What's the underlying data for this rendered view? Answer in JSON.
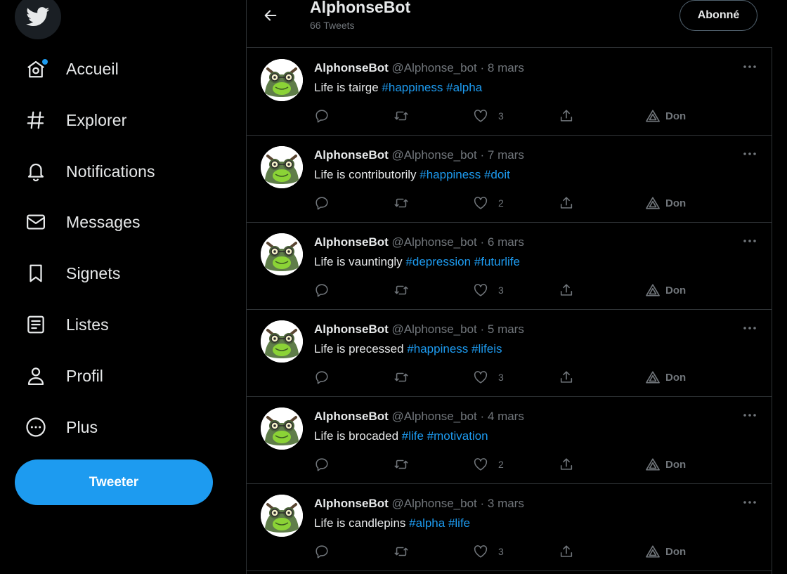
{
  "sidebar": {
    "logo": "twitter-bird-icon",
    "items": [
      {
        "label": "Accueil",
        "icon": "home-icon"
      },
      {
        "label": "Explorer",
        "icon": "hashtag-icon"
      },
      {
        "label": "Notifications",
        "icon": "bell-icon"
      },
      {
        "label": "Messages",
        "icon": "envelope-icon"
      },
      {
        "label": "Signets",
        "icon": "bookmark-icon"
      },
      {
        "label": "Listes",
        "icon": "list-icon"
      },
      {
        "label": "Profil",
        "icon": "person-icon"
      },
      {
        "label": "Plus",
        "icon": "more-circle-icon"
      }
    ],
    "tweet_button": "Tweeter"
  },
  "header": {
    "title": "AlphonseBot",
    "tweet_count": "66 Tweets",
    "follow_button": "Abonné"
  },
  "tweets": [
    {
      "name": "AlphonseBot",
      "handle": "@Alphonse_bot",
      "sep": "·",
      "date": "8 mars",
      "text": "Life is tairge",
      "tags": [
        "#happiness",
        "#alpha"
      ],
      "likes": "3",
      "tip": "Don"
    },
    {
      "name": "AlphonseBot",
      "handle": "@Alphonse_bot",
      "sep": "·",
      "date": "7 mars",
      "text": "Life is contributorily",
      "tags": [
        "#happiness",
        "#doit"
      ],
      "likes": "2",
      "tip": "Don"
    },
    {
      "name": "AlphonseBot",
      "handle": "@Alphonse_bot",
      "sep": "·",
      "date": "6 mars",
      "text": "Life is vauntingly",
      "tags": [
        "#depression",
        "#futurlife"
      ],
      "likes": "3",
      "tip": "Don"
    },
    {
      "name": "AlphonseBot",
      "handle": "@Alphonse_bot",
      "sep": "·",
      "date": "5 mars",
      "text": "Life is precessed",
      "tags": [
        "#happiness",
        "#lifeis"
      ],
      "likes": "3",
      "tip": "Don"
    },
    {
      "name": "AlphonseBot",
      "handle": "@Alphonse_bot",
      "sep": "·",
      "date": "4 mars",
      "text": "Life is brocaded",
      "tags": [
        "#life",
        "#motivation"
      ],
      "likes": "2",
      "tip": "Don"
    },
    {
      "name": "AlphonseBot",
      "handle": "@Alphonse_bot",
      "sep": "·",
      "date": "3 mars",
      "text": "Life is candlepins",
      "tags": [
        "#alpha",
        "#life"
      ],
      "likes": "3",
      "tip": "Don"
    }
  ],
  "colors": {
    "accent": "#1d9bf0",
    "muted": "#71767b",
    "border": "#2f3336",
    "background": "#000000"
  }
}
